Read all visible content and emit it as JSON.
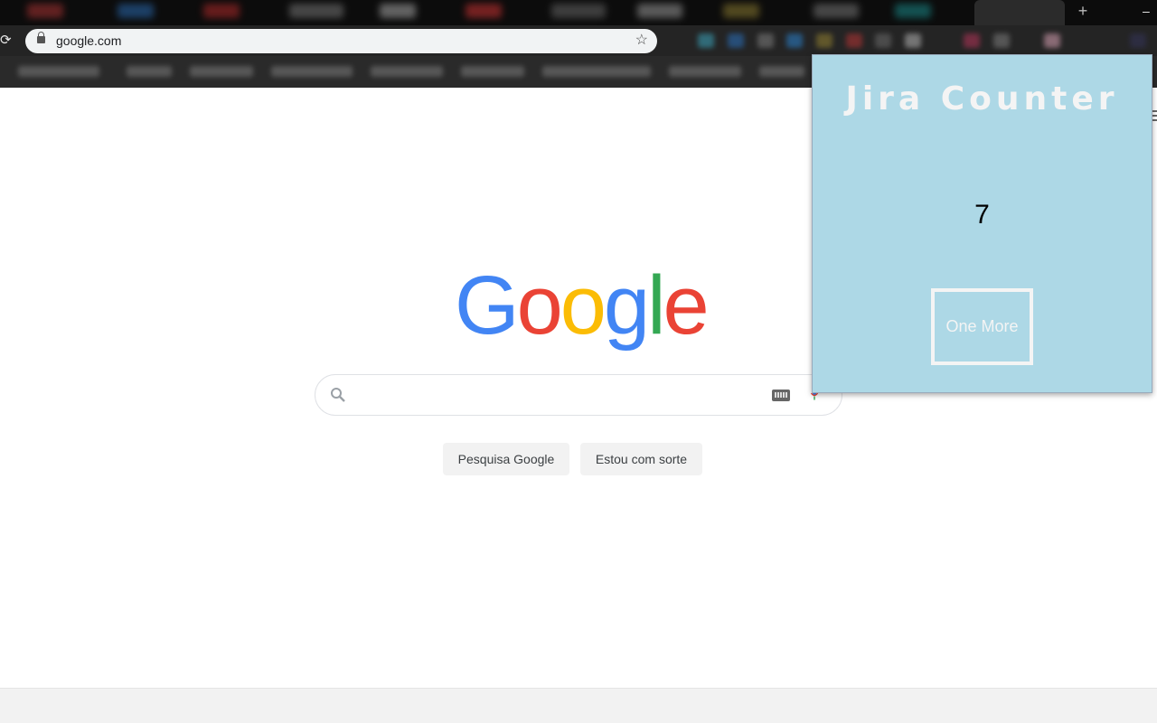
{
  "browser": {
    "url": "google.com",
    "newtab_glyph": "+",
    "minimize_glyph": "–",
    "reload_glyph": "⟳",
    "star_glyph": "☆"
  },
  "google": {
    "logo_letters": [
      {
        "char": "G",
        "color": "#4285F4"
      },
      {
        "char": "o",
        "color": "#EA4335"
      },
      {
        "char": "o",
        "color": "#FBBC05"
      },
      {
        "char": "g",
        "color": "#4285F4"
      },
      {
        "char": "l",
        "color": "#34A853"
      },
      {
        "char": "e",
        "color": "#EA4335"
      }
    ],
    "search_button": "Pesquisa Google",
    "lucky_button": "Estou com sorte"
  },
  "extension": {
    "title": "Jira Counter",
    "count": "7",
    "button": "One More",
    "background": "#add8e6"
  }
}
